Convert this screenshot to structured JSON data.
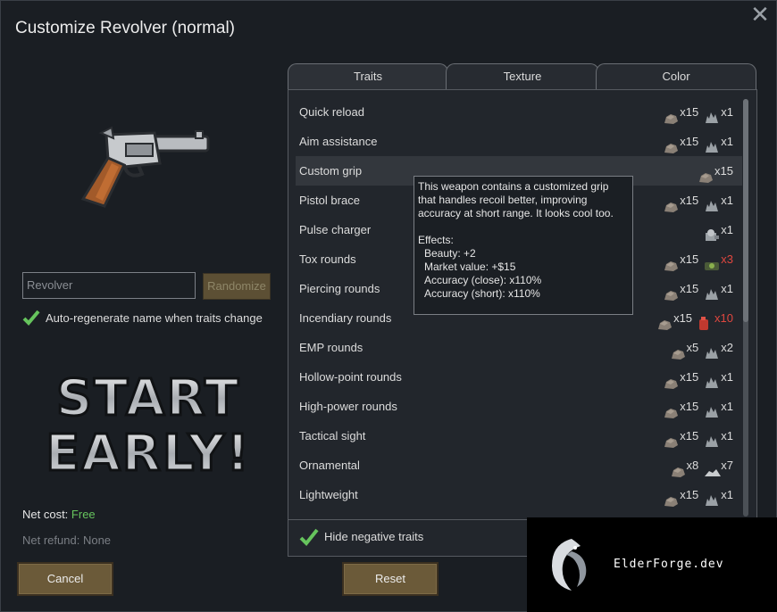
{
  "window": {
    "title": "Customize Revolver (normal)",
    "close_glyph": "✕"
  },
  "weapon_image": {
    "icon": "revolver-icon"
  },
  "name_field": {
    "value": "Revolver"
  },
  "randomize_label": "Randomize",
  "auto_regen": {
    "checked": true,
    "label": "Auto-regenerate name when traits change"
  },
  "banner": {
    "line1": "START",
    "line2": "EARLY!"
  },
  "net_cost": {
    "label": "Net cost:",
    "value": "Free"
  },
  "net_refund": {
    "label": "Net refund:",
    "value": "None"
  },
  "buttons": {
    "cancel": "Cancel",
    "reset": "Reset"
  },
  "tabs": [
    {
      "label": "Traits",
      "active": true
    },
    {
      "label": "Texture",
      "active": false
    },
    {
      "label": "Color",
      "active": false
    }
  ],
  "traits": [
    {
      "name": "Quick reload",
      "costs": [
        {
          "icon": "stone-icon",
          "amount": "x15"
        },
        {
          "icon": "metal-icon",
          "amount": "x1"
        }
      ]
    },
    {
      "name": "Aim assistance",
      "costs": [
        {
          "icon": "stone-icon",
          "amount": "x15"
        },
        {
          "icon": "metal-icon",
          "amount": "x1"
        }
      ]
    },
    {
      "name": "Custom grip",
      "highlighted": true,
      "costs": [
        {
          "icon": "stone-icon",
          "amount": "x15"
        }
      ]
    },
    {
      "name": "Pistol brace",
      "costs": [
        {
          "icon": "stone-icon",
          "amount": "x15"
        },
        {
          "icon": "metal-icon",
          "amount": "x1"
        }
      ]
    },
    {
      "name": "Pulse charger",
      "costs": [
        {
          "icon": "component-icon",
          "amount": "x1"
        }
      ]
    },
    {
      "name": "Tox rounds",
      "costs": [
        {
          "icon": "stone-icon",
          "amount": "x15"
        },
        {
          "icon": "toxin-icon",
          "amount": "x3",
          "insufficient": true
        }
      ]
    },
    {
      "name": "Piercing rounds",
      "costs": [
        {
          "icon": "stone-icon",
          "amount": "x15"
        },
        {
          "icon": "metal-icon",
          "amount": "x1"
        }
      ]
    },
    {
      "name": "Incendiary rounds",
      "costs": [
        {
          "icon": "stone-icon",
          "amount": "x15"
        },
        {
          "icon": "fuel-icon",
          "amount": "x10",
          "insufficient": true
        }
      ]
    },
    {
      "name": "EMP rounds",
      "costs": [
        {
          "icon": "stone-icon",
          "amount": "x5"
        },
        {
          "icon": "metal-icon",
          "amount": "x2"
        }
      ]
    },
    {
      "name": "Hollow-point rounds",
      "costs": [
        {
          "icon": "stone-icon",
          "amount": "x15"
        },
        {
          "icon": "metal-icon",
          "amount": "x1"
        }
      ]
    },
    {
      "name": "High-power rounds",
      "costs": [
        {
          "icon": "stone-icon",
          "amount": "x15"
        },
        {
          "icon": "metal-icon",
          "amount": "x1"
        }
      ]
    },
    {
      "name": "Tactical sight",
      "costs": [
        {
          "icon": "stone-icon",
          "amount": "x15"
        },
        {
          "icon": "metal-icon",
          "amount": "x1"
        }
      ]
    },
    {
      "name": "Ornamental",
      "costs": [
        {
          "icon": "stone-icon",
          "amount": "x8"
        },
        {
          "icon": "silver-icon",
          "amount": "x7"
        }
      ]
    },
    {
      "name": "Lightweight",
      "costs": [
        {
          "icon": "stone-icon",
          "amount": "x15"
        },
        {
          "icon": "metal-icon",
          "amount": "x1"
        }
      ]
    }
  ],
  "hide_negative": {
    "checked": true,
    "label": "Hide negative traits"
  },
  "tooltip": {
    "description": "This weapon contains a customized grip that handles recoil better, improving accuracy at short range. It looks cool too.",
    "effects_header": "Effects:",
    "effects": [
      "Beauty: +2",
      "Market value: +$15",
      "Accuracy (close): x110%",
      "Accuracy (short): x110%"
    ]
  },
  "watermark": {
    "text": "ElderForge.dev"
  },
  "colors": {
    "accent_green": "#66c45d",
    "insufficient_red": "#e0473f",
    "button_brown": "#6b5a39"
  }
}
